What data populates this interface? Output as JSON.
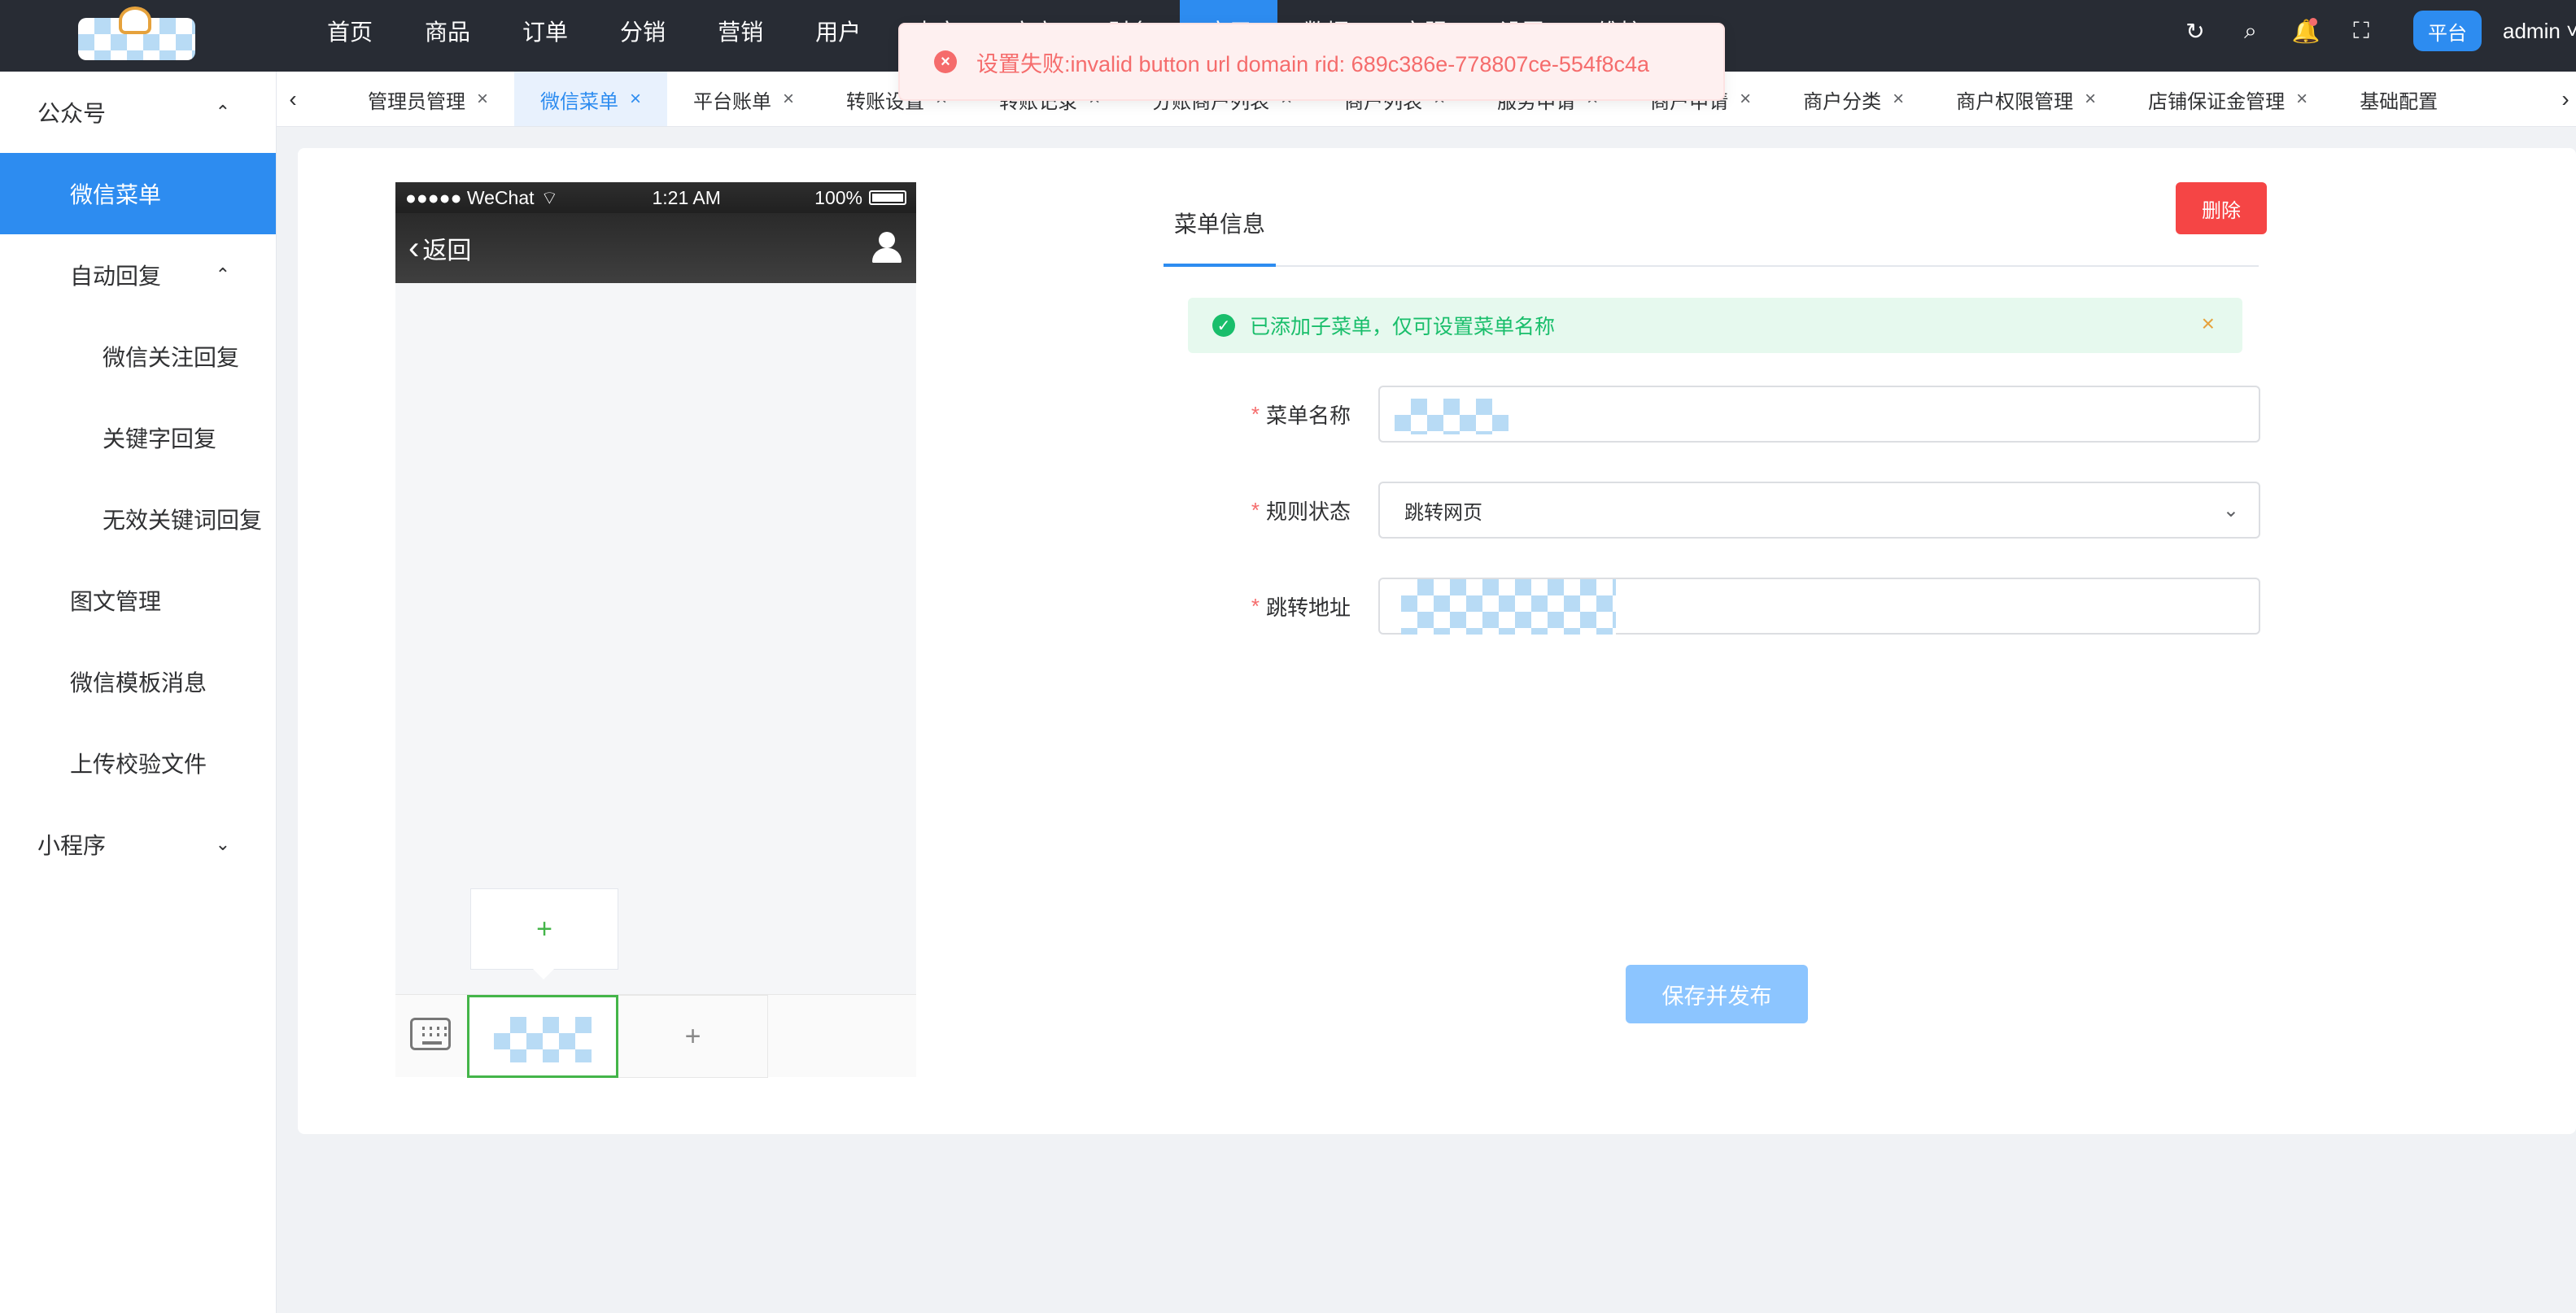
{
  "topbar": {
    "nav": [
      {
        "label": "首页"
      },
      {
        "label": "商品"
      },
      {
        "label": "订单"
      },
      {
        "label": "分销"
      },
      {
        "label": "营销"
      },
      {
        "label": "用户"
      },
      {
        "label": "内容"
      },
      {
        "label": "商户"
      },
      {
        "label": "财务"
      },
      {
        "label": "应用"
      },
      {
        "label": "数据"
      },
      {
        "label": "客服"
      },
      {
        "label": "设置"
      },
      {
        "label": "维护"
      }
    ],
    "icons": {
      "refresh": "↻",
      "search": "⌕",
      "bell": "🔔",
      "fullscreen": "⛶"
    },
    "platform_label": "平台",
    "user_name": "admin ˅"
  },
  "tabs": {
    "prev": "‹",
    "next": "›",
    "close": "×",
    "items": [
      {
        "label": "管理员管理"
      },
      {
        "label": "微信菜单"
      },
      {
        "label": "平台账单"
      },
      {
        "label": "转账设置"
      },
      {
        "label": "转账记录"
      },
      {
        "label": "分账商户列表"
      },
      {
        "label": "商户列表"
      },
      {
        "label": "服务申请"
      },
      {
        "label": "商户申请"
      },
      {
        "label": "商户分类"
      },
      {
        "label": "商户权限管理"
      },
      {
        "label": "店铺保证金管理"
      },
      {
        "label": "基础配置"
      }
    ]
  },
  "sidebar": {
    "items": [
      {
        "label": "公众号",
        "chev": "⌃"
      },
      {
        "label": "微信菜单"
      },
      {
        "label": "自动回复",
        "chev": "⌃"
      },
      {
        "label": "微信关注回复"
      },
      {
        "label": "关键字回复"
      },
      {
        "label": "无效关键词回复"
      },
      {
        "label": "图文管理"
      },
      {
        "label": "微信模板消息"
      },
      {
        "label": "上传校验文件"
      },
      {
        "label": "小程序",
        "chev": "⌄"
      }
    ]
  },
  "phone": {
    "carrier": "●●●●● WeChat",
    "wifi": "⌔",
    "time": "1:21 AM",
    "battery": "100%",
    "back_arrow": "‹",
    "back_label": "返回",
    "plus": "+"
  },
  "panel": {
    "tab_label": "菜单信息",
    "delete_label": "删除",
    "alert_text": "已添加子菜单，仅可设置菜单名称",
    "alert_ok": "✓",
    "alert_close": "×",
    "name_label": "菜单名称",
    "rule_label": "规则状态",
    "rule_value": "跳转网页",
    "rule_arrow": "⌄",
    "url_label": "跳转地址",
    "required_mark": "*",
    "save_label": "保存并发布"
  },
  "toast": {
    "icon": "×",
    "message": "设置失败:invalid button url domain rid: 689c386e-778807ce-554f8c4a"
  },
  "colors": {
    "topbar_bg": "#282c34",
    "accent": "#2d8cf0",
    "danger": "#f54545",
    "success": "#19be6b",
    "wechat_green": "#44b549"
  }
}
